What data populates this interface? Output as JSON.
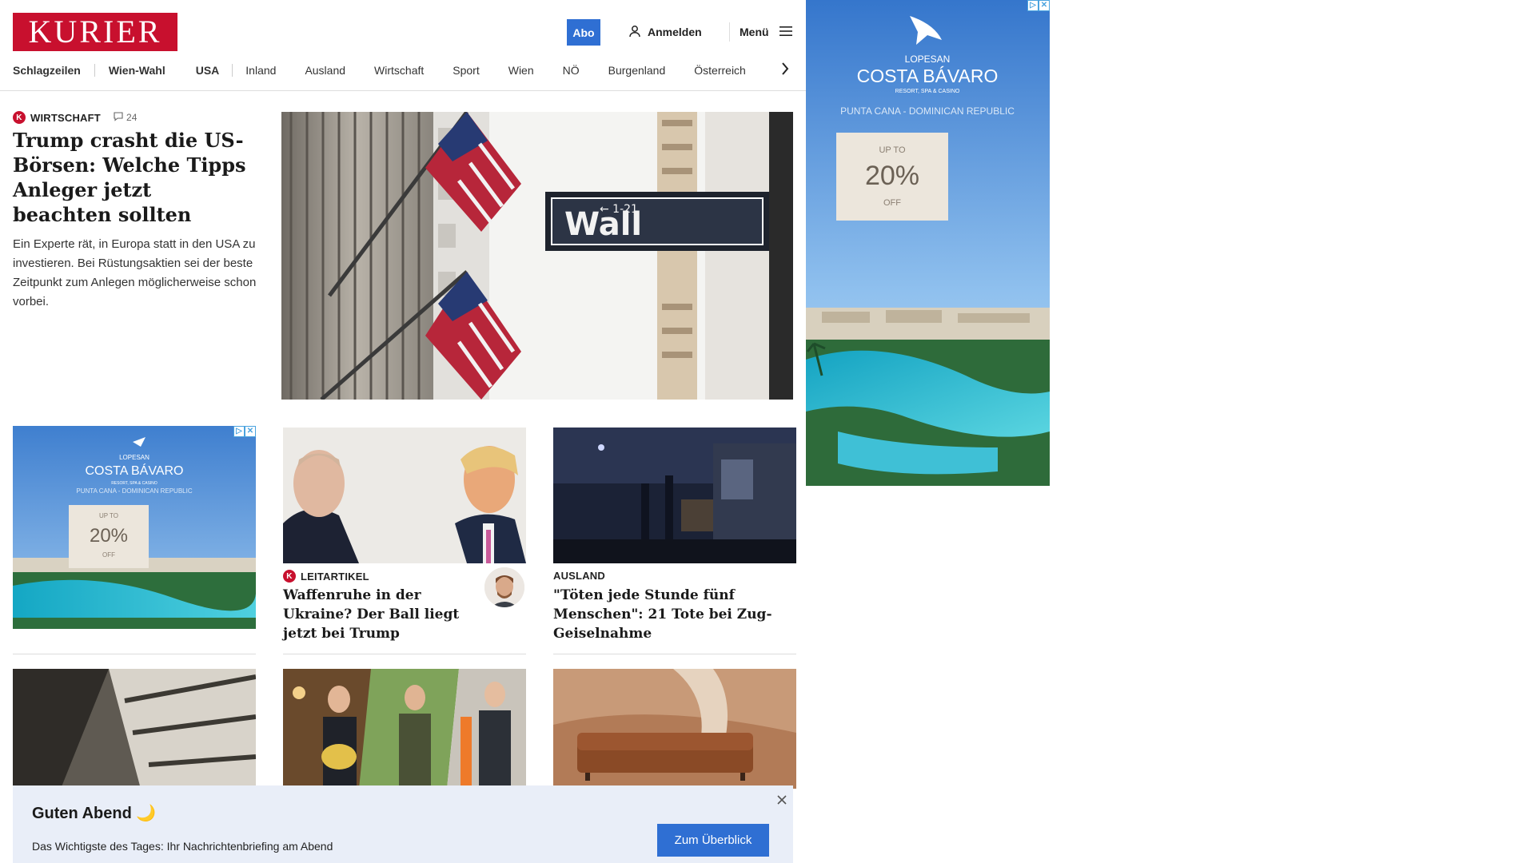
{
  "header": {
    "logo_text": "KURIER",
    "abo_label": "Abo",
    "login_label": "Anmelden",
    "menu_label": "Menü"
  },
  "nav": {
    "items": [
      {
        "label": "Schlagzeilen",
        "bold": true
      },
      {
        "label": "Wien-Wahl",
        "bold": true
      },
      {
        "label": "USA",
        "bold": true
      },
      {
        "label": "Inland",
        "bold": false
      },
      {
        "label": "Ausland",
        "bold": false
      },
      {
        "label": "Wirtschaft",
        "bold": false
      },
      {
        "label": "Sport",
        "bold": false
      },
      {
        "label": "Wien",
        "bold": false
      },
      {
        "label": "NÖ",
        "bold": false
      },
      {
        "label": "Burgenland",
        "bold": false
      },
      {
        "label": "Österreich",
        "bold": false
      }
    ]
  },
  "lead": {
    "kicker": "WIRTSCHAFT",
    "comments": "24",
    "title": "Trump crasht die US-Börsen: Welche Tipps Anleger jetzt beachten sollten",
    "teaser": "Ein Experte rät, in Europa statt in den USA zu investieren. Bei Rüstungsaktien sei der beste Zeitpunkt zum Anlegen möglicherweise schon vorbei.",
    "image_sign_text": "Wall",
    "image_sign_small": "← 1-21"
  },
  "cards": [
    {
      "kicker": "LEITARTIKEL",
      "title": "Waffenruhe in der Ukraine? Der Ball liegt jetzt bei Trump"
    },
    {
      "kicker": "AUSLAND",
      "title": "\"Töten jede Stunde fünf Menschen\": 21 Tote bei Zug-Geiselnahme"
    }
  ],
  "ads": {
    "brand_small": "LOPESAN",
    "brand": "COSTA BÁVARO",
    "tagline": "RESORT, SPA & CASINO",
    "location": "PUNTA CANA - DOMINICAN REPUBLIC",
    "up_to": "UP TO",
    "percent": "20%",
    "off": "OFF"
  },
  "banner": {
    "title": "Guten Abend 🌙",
    "text": "Das Wichtigste des Tages: Ihr Nachrichtenbriefing am Abend",
    "button": "Zum Überblick"
  },
  "colors": {
    "brand_red": "#c8102e",
    "accent_blue": "#2f6fd3",
    "banner_bg": "#e9eef8"
  }
}
